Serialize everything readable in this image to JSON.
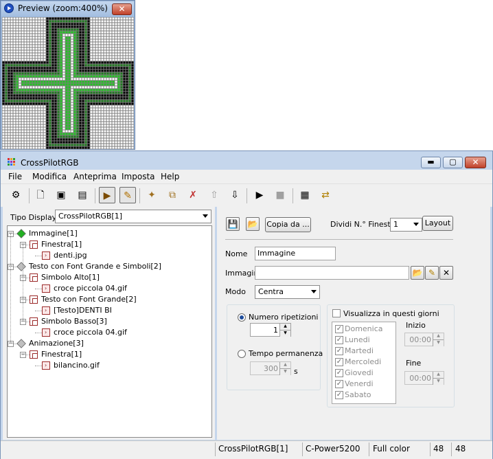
{
  "preview": {
    "title": "Preview (zoom:400%)",
    "close_label": "✕"
  },
  "main": {
    "title": "CrossPilotRGB",
    "caption": {
      "minimize": "▬",
      "maximize": "▢",
      "close": "✕"
    }
  },
  "menu": [
    "File",
    "Modifica",
    "Anteprima",
    "Imposta",
    "Help"
  ],
  "toolbar_icons": [
    "settings-icon",
    "new-file-icon",
    "import-icon",
    "export-icon",
    "preview-mode-icon",
    "edit-mode-icon",
    "add-item-icon",
    "copy-item-icon",
    "delete-item-icon",
    "move-up-icon",
    "move-down-icon",
    "play-icon",
    "stop-icon",
    "display-icon",
    "send-icon"
  ],
  "tipo_display": {
    "label": "Tipo Display",
    "value": "CrossPilotRGB[1]"
  },
  "tree": [
    {
      "label": "Immagine[1]",
      "level": 0,
      "icon": "green-diamond"
    },
    {
      "label": "Finestra[1]",
      "level": 1,
      "icon": "window"
    },
    {
      "label": "denti.jpg",
      "level": 2,
      "icon": "file"
    },
    {
      "label": "Testo con Font Grande e Simboli[2]",
      "level": 0,
      "icon": "gray-diamond"
    },
    {
      "label": "Simbolo Alto[1]",
      "level": 1,
      "icon": "window"
    },
    {
      "label": "croce piccola 04.gif",
      "level": 2,
      "icon": "file"
    },
    {
      "label": "Testo con Font Grande[2]",
      "level": 1,
      "icon": "window"
    },
    {
      "label": "[Testo]DENTI BI",
      "level": 2,
      "icon": "file"
    },
    {
      "label": "Simbolo Basso[3]",
      "level": 1,
      "icon": "window"
    },
    {
      "label": "croce piccola 04.gif",
      "level": 2,
      "icon": "file"
    },
    {
      "label": "Animazione[3]",
      "level": 0,
      "icon": "gray-diamond"
    },
    {
      "label": "Finestra[1]",
      "level": 1,
      "icon": "window"
    },
    {
      "label": "bilancino.gif",
      "level": 2,
      "icon": "file"
    }
  ],
  "editor": {
    "copia_da": "Copia da ...",
    "dividi_label": "Dividi N.° Finestra",
    "dividi_value": "1",
    "layout": "Layout",
    "nome_label": "Nome",
    "nome_value": "Immagine",
    "immagin_label": "Immagin",
    "immagin_value": "",
    "modo_label": "Modo",
    "modo_value": "Centra",
    "numero_ripetizioni": "Numero ripetizioni",
    "ripetizioni_value": "1",
    "tempo_permanenza": "Tempo permanenza",
    "tempo_value": "300",
    "tempo_unit": "s",
    "visualizza": "Visualizza in questi giorni",
    "days": [
      "Domenica",
      "Lunedi",
      "Martedi",
      "Mercoledi",
      "Giovedi",
      "Venerdi",
      "Sabato"
    ],
    "inizio_label": "Inizio",
    "inizio_value": "00:00",
    "fine_label": "Fine",
    "fine_value": "00:00"
  },
  "status": {
    "display": "CrossPilotRGB[1]",
    "controller": "C-Power5200",
    "color": "Full color",
    "width": "48",
    "height": "48"
  },
  "colors": {
    "pixel_dark": "#000000",
    "pixel_outline": "#1f7a1f",
    "pixel_bright": "#22c422",
    "pixel_off": "#ffffff",
    "window_frame": "#c5d6ec"
  }
}
